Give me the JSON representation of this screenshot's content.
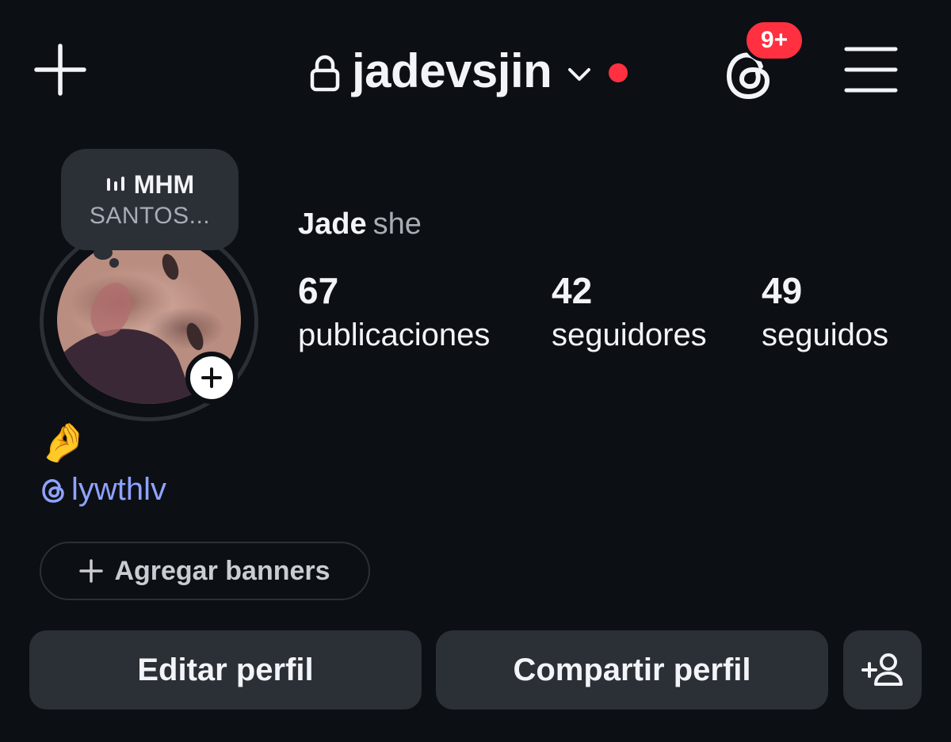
{
  "header": {
    "username": "jadevsjin",
    "notification_badge": "9+",
    "accent_red": "#ff3040"
  },
  "note": {
    "title": "MHM",
    "subtitle": "SANTOS..."
  },
  "profile": {
    "name": "Jade",
    "pronouns": "she",
    "stats": [
      {
        "value": "67",
        "label": "publicaciones"
      },
      {
        "value": "42",
        "label": "seguidores"
      },
      {
        "value": "49",
        "label": "seguidos"
      }
    ],
    "bio_emoji": "🤌",
    "threads_handle": "lywthlv",
    "link_color": "#8ea3ff"
  },
  "buttons": {
    "add_banners": "Agregar banners",
    "edit_profile": "Editar perfil",
    "share_profile": "Compartir perfil"
  },
  "icons": [
    "plus-icon",
    "lock-icon",
    "chevron-down-icon",
    "threads-icon",
    "menu-icon",
    "waveform-icon",
    "add-person-icon"
  ]
}
